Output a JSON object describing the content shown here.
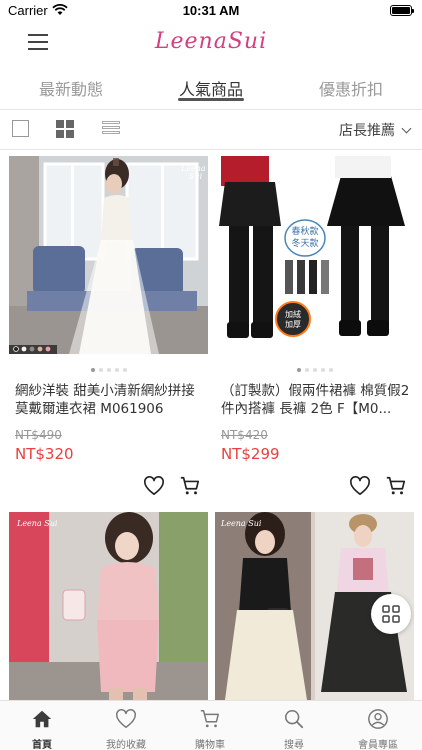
{
  "status_bar": {
    "carrier": "Carrier",
    "time": "10:31 AM"
  },
  "header": {
    "brand": "LeenaSui"
  },
  "tabs": [
    {
      "label": "最新動態",
      "active": false
    },
    {
      "label": "人氣商品",
      "active": true
    },
    {
      "label": "優惠折扣",
      "active": false
    }
  ],
  "toolbar": {
    "sort_label": "店長推薦"
  },
  "products": [
    {
      "name": "網紗洋裝 甜美小清新網紗拼接莫戴爾連衣裙 M061906",
      "old_price": "NT$490",
      "price": "NT$320",
      "logo": "Leena Sui"
    },
    {
      "name": "（訂製款）假兩件裙褲 棉質假2件內搭褲 長褲 2色 F【M0...",
      "old_price": "NT$420",
      "price": "NT$299",
      "badge_top": "春秋款",
      "badge_bottom": "冬天款",
      "badge_hot_1": "加絨",
      "badge_hot_2": "加厚"
    },
    {
      "logo": "Leena Sui"
    },
    {
      "logo": "Leena Sui"
    }
  ],
  "bottom_nav": [
    {
      "label": "首頁",
      "icon": "home-icon",
      "active": true
    },
    {
      "label": "我的收藏",
      "icon": "heart-icon",
      "active": false
    },
    {
      "label": "購物車",
      "icon": "cart-icon",
      "active": false
    },
    {
      "label": "搜尋",
      "icon": "search-icon",
      "active": false
    },
    {
      "label": "會員專區",
      "icon": "user-icon",
      "active": false
    }
  ],
  "colors": {
    "brand": "#d2407f",
    "price": "#e8403f"
  }
}
